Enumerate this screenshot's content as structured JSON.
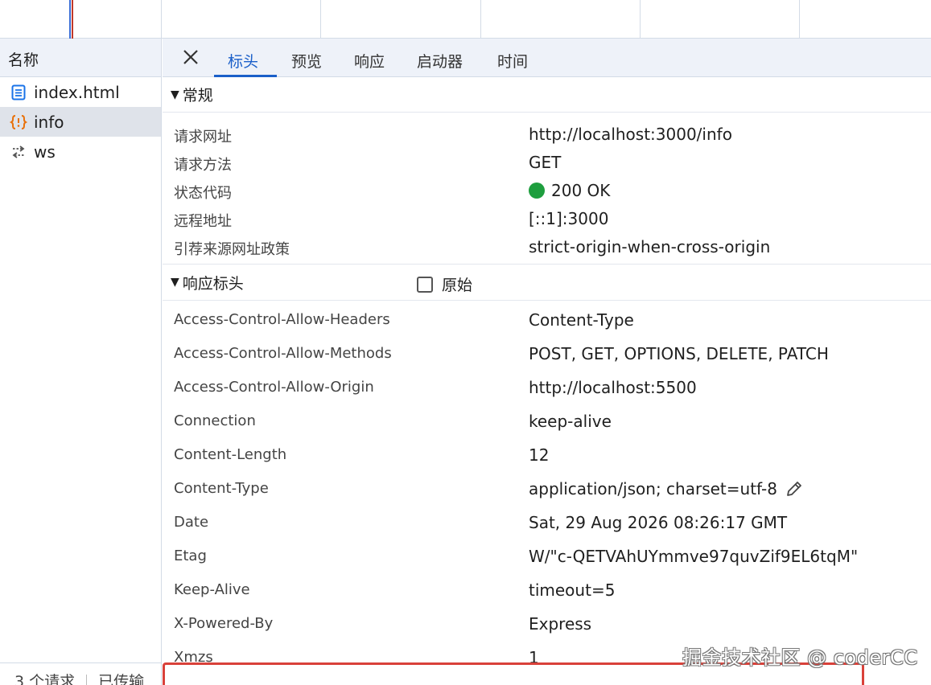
{
  "request_list": {
    "header": "名称",
    "items": [
      {
        "name": "index.html",
        "icon": "document-icon",
        "selected": false
      },
      {
        "name": "info",
        "icon": "json-braces-icon",
        "selected": true
      },
      {
        "name": "ws",
        "icon": "websocket-arrows-icon",
        "selected": false
      }
    ],
    "footer_count": "3 个请求",
    "footer_transferred": "已传输"
  },
  "tabs": {
    "close_label": "×",
    "items": [
      "标头",
      "预览",
      "响应",
      "启动器",
      "时间"
    ],
    "active": "标头"
  },
  "general": {
    "title": "常规",
    "rows": [
      {
        "key": "请求网址",
        "value": "http://localhost:3000/info"
      },
      {
        "key": "请求方法",
        "value": "GET"
      },
      {
        "key": "状态代码",
        "value": "200 OK"
      },
      {
        "key": "远程地址",
        "value": "[::1]:3000"
      },
      {
        "key": "引荐来源网址政策",
        "value": "strict-origin-when-cross-origin"
      }
    ]
  },
  "response_headers": {
    "title": "响应标头",
    "raw_label": "原始",
    "raw_checked": false,
    "rows": [
      {
        "key": "Access-Control-Allow-Headers",
        "value": "Content-Type"
      },
      {
        "key": "Access-Control-Allow-Methods",
        "value": "POST, GET, OPTIONS, DELETE, PATCH"
      },
      {
        "key": "Access-Control-Allow-Origin",
        "value": "http://localhost:5500"
      },
      {
        "key": "Connection",
        "value": "keep-alive"
      },
      {
        "key": "Content-Length",
        "value": "12"
      },
      {
        "key": "Content-Type",
        "value": "application/json; charset=utf-8"
      },
      {
        "key": "Date",
        "value": "Sat, 29 Aug 2026 08:26:17 GMT"
      },
      {
        "key": "Etag",
        "value": "W/\"c-QETVAhUYmmve97quvZif9EL6tqM\""
      },
      {
        "key": "Keep-Alive",
        "value": "timeout=5"
      },
      {
        "key": "X-Powered-By",
        "value": "Express"
      },
      {
        "key": "Xmzs",
        "value": "1"
      }
    ]
  },
  "watermark": "掘金技术社区 @ coderCC",
  "colors": {
    "accent": "#1a5fc9",
    "status_ok": "#1e9e3e",
    "highlight": "#d9413a",
    "json_icon": "#e8710a",
    "doc_icon": "#1a73e8"
  }
}
